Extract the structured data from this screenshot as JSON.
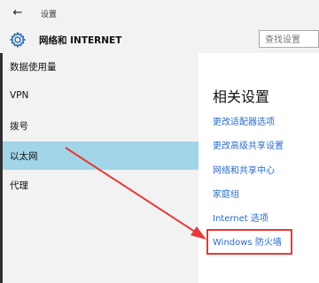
{
  "titlebar": {
    "title": "设置",
    "back_icon": "back-arrow-icon"
  },
  "header": {
    "title": "网络和 INTERNET",
    "icon": "gear-icon",
    "search_placeholder": "查找设置"
  },
  "sidebar": {
    "items": [
      {
        "label": "数据使用量",
        "selected": false
      },
      {
        "label": "VPN",
        "selected": false
      },
      {
        "label": "拨号",
        "selected": false
      },
      {
        "label": "以太网",
        "selected": true
      },
      {
        "label": "代理",
        "selected": false
      }
    ],
    "selected_color": "#a2d5e7"
  },
  "main": {
    "section_title": "相关设置",
    "links": [
      "更改适配器选项",
      "更改高级共享设置",
      "网络和共享中心",
      "家庭组",
      "Internet 选项",
      "Windows 防火墙"
    ],
    "link_color": "#2b6bc4",
    "annotation_color": "#e53a3a"
  }
}
